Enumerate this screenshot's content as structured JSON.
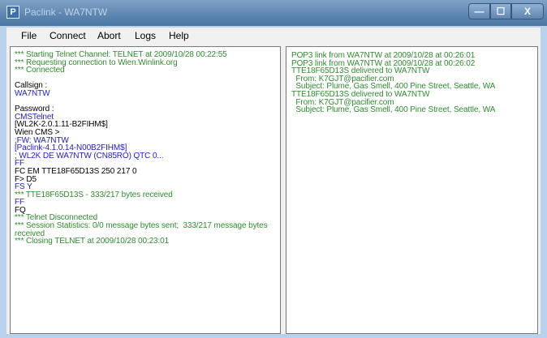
{
  "window": {
    "title": "Paclink - WA7NTW",
    "controls": {
      "minimize": "—",
      "maximize": "☐",
      "close": "X"
    }
  },
  "menu": [
    "File",
    "Connect",
    "Abort",
    "Logs",
    "Help"
  ],
  "left_pane": {
    "lines": [
      {
        "text": "*** Starting Telnet Channel: TELNET at 2009/10/28 00:22:55",
        "color": "green"
      },
      {
        "text": "*** Requesting connection to Wien.Winlink.org",
        "color": "green"
      },
      {
        "text": "*** Connected",
        "color": "green"
      },
      {
        "text": "",
        "color": "black"
      },
      {
        "text": "Callsign :",
        "color": "black"
      },
      {
        "text": "WA7NTW",
        "color": "blue"
      },
      {
        "text": "",
        "color": "black"
      },
      {
        "text": "Password :",
        "color": "black"
      },
      {
        "text": "CMSTelnet",
        "color": "blue"
      },
      {
        "text": "[WL2K-2.0.1.11-B2FIHM$]",
        "color": "black"
      },
      {
        "text": "Wien CMS >",
        "color": "black"
      },
      {
        "text": ";FW: WA7NTW",
        "color": "blue"
      },
      {
        "text": "[Paclink-4.1.0.14-N00B2FIHM$]",
        "color": "blue"
      },
      {
        "text": "; WL2K DE WA7NTW (CN85RO) QTC 0...",
        "color": "blue"
      },
      {
        "text": "FF",
        "color": "blue"
      },
      {
        "text": "FC EM TTE18F65D13S 250 217 0",
        "color": "black"
      },
      {
        "text": "F> D5",
        "color": "black"
      },
      {
        "text": "FS Y",
        "color": "blue"
      },
      {
        "text": "*** TTE18F65D13S - 333/217 bytes received",
        "color": "green"
      },
      {
        "text": "FF",
        "color": "blue"
      },
      {
        "text": "FQ",
        "color": "black"
      },
      {
        "text": "*** Telnet Disconnected",
        "color": "green"
      },
      {
        "text": "*** Session Statistics: 0/0 message bytes sent;  333/217 message bytes",
        "color": "green"
      },
      {
        "text": "received",
        "color": "green"
      },
      {
        "text": "*** Closing TELNET at 2009/10/28 00:23:01",
        "color": "green"
      }
    ]
  },
  "right_pane": {
    "lines": [
      {
        "text": "POP3 link from WA7NTW at 2009/10/28 at 00:26:01",
        "color": "green"
      },
      {
        "text": "POP3 link from WA7NTW at 2009/10/28 at 00:26:02",
        "color": "green"
      },
      {
        "text": "TTE18F65D13S delivered to WA7NTW",
        "color": "green"
      },
      {
        "text": "  From: K7GJT@pacifier.com",
        "color": "green"
      },
      {
        "text": "  Subject: Plume, Gas Smell, 400 Pine Street, Seattle, WA",
        "color": "green"
      },
      {
        "text": "TTE18F65D13S delivered to WA7NTW",
        "color": "green"
      },
      {
        "text": "  From: K7GJT@pacifier.com",
        "color": "green"
      },
      {
        "text": "  Subject: Plume, Gas Smell, 400 Pine Street, Seattle, WA",
        "color": "green"
      }
    ]
  },
  "colors": {
    "green": "#2e8b2e",
    "blue": "#2020d0",
    "black": "#000000"
  }
}
